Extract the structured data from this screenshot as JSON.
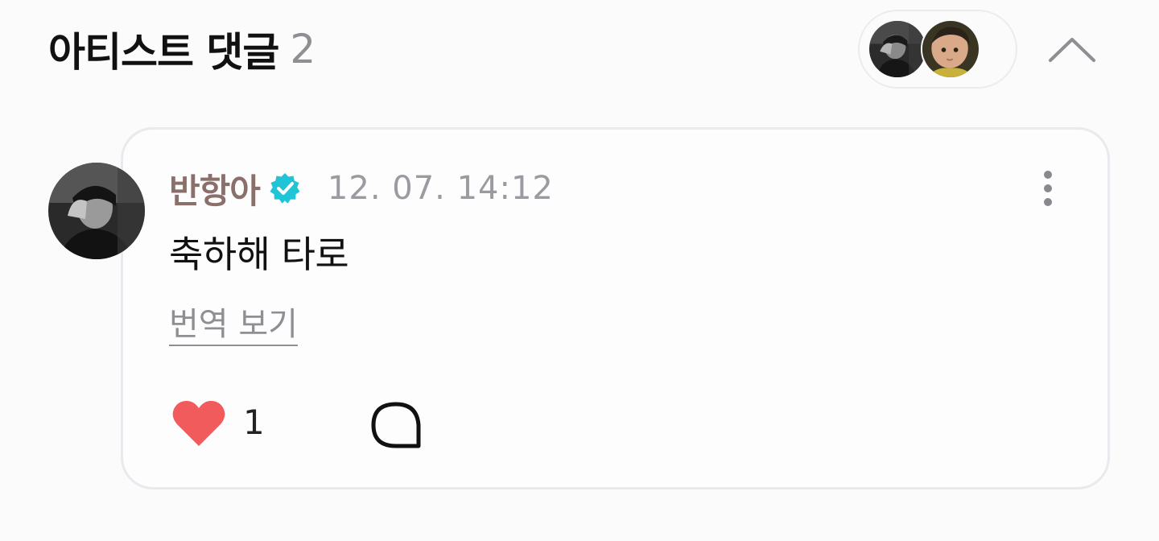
{
  "header": {
    "title": "아티스트 댓글",
    "count": "2"
  },
  "comment": {
    "author": "반항아",
    "timestamp": "12. 07. 14:12",
    "text": "축하해 타로",
    "translate_label": "번역 보기",
    "like_count": "1"
  },
  "icons": {
    "collapse": "chevron-up-icon",
    "verified": "verified-badge-icon",
    "more": "more-vertical-icon",
    "like": "heart-icon",
    "reply": "comment-bubble-icon"
  },
  "colors": {
    "author_name": "#8a6f6a",
    "verified_badge": "#1fc4d6",
    "heart": "#f25b5b",
    "muted_text": "#8e8e93"
  }
}
